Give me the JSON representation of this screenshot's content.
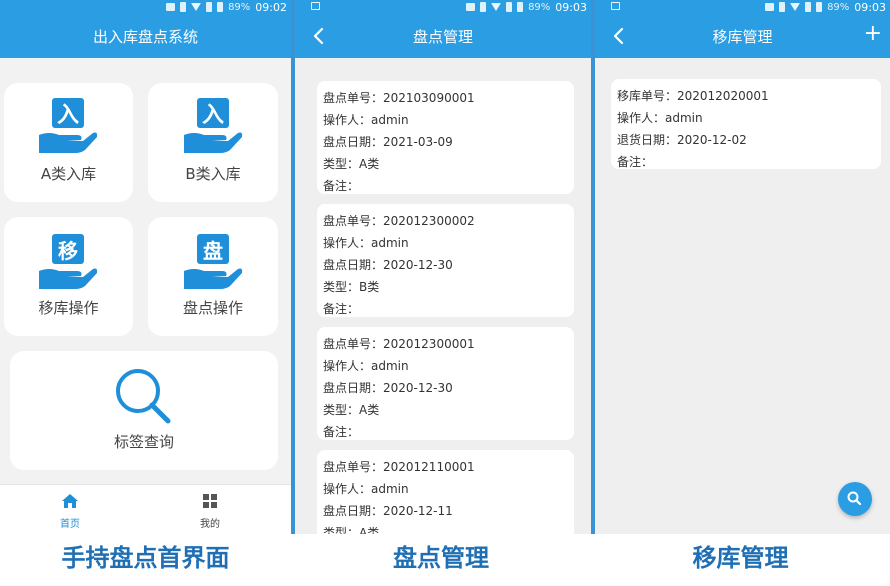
{
  "status": {
    "battery": "89%",
    "time_1": "09:02",
    "time_2": "09:03",
    "time_3": "09:03"
  },
  "screen1": {
    "title": "出入库盘点系统",
    "tiles": [
      {
        "label": "A类入库",
        "glyph": "入"
      },
      {
        "label": "B类入库",
        "glyph": "入"
      },
      {
        "label": "移库操作",
        "glyph": "移"
      },
      {
        "label": "盘点操作",
        "glyph": "盘"
      },
      {
        "label": "标签查询"
      }
    ],
    "tabs": [
      {
        "label": "首页",
        "active": true
      },
      {
        "label": "我的",
        "active": false
      }
    ],
    "colors": {
      "primary": "#2b9ee3",
      "icon": "#1e8fd8"
    }
  },
  "screen2": {
    "title": "盘点管理",
    "cards": [
      {
        "no": "盘点单号：202103090001",
        "op": "操作人：admin",
        "date": "盘点日期：2021-03-09",
        "type": "类型：A类",
        "note": "备注："
      },
      {
        "no": "盘点单号：202012300002",
        "op": "操作人：admin",
        "date": "盘点日期：2020-12-30",
        "type": "类型：B类",
        "note": "备注："
      },
      {
        "no": "盘点单号：202012300001",
        "op": "操作人：admin",
        "date": "盘点日期：2020-12-30",
        "type": "类型：A类",
        "note": "备注："
      },
      {
        "no": "盘点单号：202012110001",
        "op": "操作人：admin",
        "date": "盘点日期：2020-12-11",
        "type": "类型：A类"
      }
    ]
  },
  "screen3": {
    "title": "移库管理",
    "add_label": "+",
    "card": {
      "no": "移库单号：202012020001",
      "op": "操作人：admin",
      "date": "退货日期：2020-12-02",
      "note": "备注："
    }
  },
  "captions": [
    "手持盘点首界面",
    "盘点管理",
    "移库管理"
  ]
}
